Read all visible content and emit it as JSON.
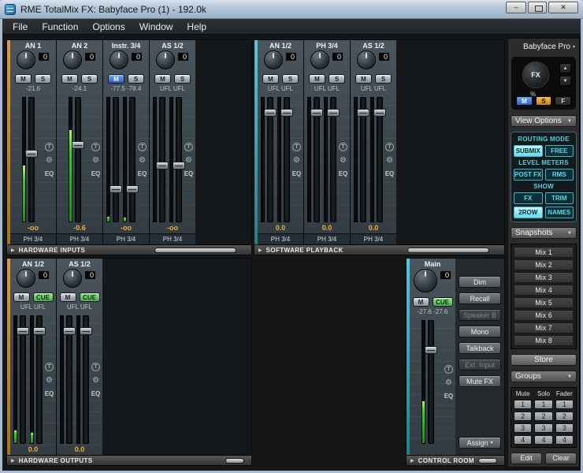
{
  "window": {
    "title": "RME TotalMix FX: Babyface Pro (1) - 192.0k",
    "controls": {
      "minimize": "–",
      "close": "✕"
    }
  },
  "menu": {
    "items": [
      "File",
      "Function",
      "Options",
      "Window",
      "Help"
    ]
  },
  "strip_common": {
    "trim": "T",
    "wrench": "⚙",
    "eq": "EQ"
  },
  "sections": {
    "hardware_inputs": {
      "bar_label": "HARDWARE INPUTS",
      "strips": [
        {
          "name": "AN 1",
          "gain": "0",
          "mute": "M",
          "solo": "S",
          "level": "-21.6",
          "stereo": false,
          "fader": 0.45,
          "meters": [
            0.45
          ],
          "value": "-oo",
          "route": "PH 3/4"
        },
        {
          "name": "AN 2",
          "gain": "0",
          "mute": "M",
          "solo": "S",
          "level": "-24.1",
          "stereo": false,
          "fader": 0.38,
          "meters": [
            0.74
          ],
          "value": "-0.6",
          "route": "PH 3/4"
        },
        {
          "name": "Instr. 3/4",
          "gain": "0",
          "mute": "M",
          "solo": "S",
          "mute_active": true,
          "level": "-77.5 -78.4",
          "stereo": true,
          "fader": 0.74,
          "meters": [
            0.04,
            0.03
          ],
          "value": "-oo",
          "route": "PH 3/4"
        },
        {
          "name": "AS 1/2",
          "gain": "0",
          "mute": "M",
          "solo": "S",
          "level": "UFL UFL",
          "stereo": true,
          "fader": 0.55,
          "meters": [
            0,
            0
          ],
          "value": "-oo",
          "route": "PH 3/4"
        }
      ]
    },
    "software_playback": {
      "bar_label": "SOFTWARE PLAYBACK",
      "strips": [
        {
          "name": "AN 1/2",
          "gain": "0",
          "mute": "M",
          "solo": "S",
          "level": "UFL UFL",
          "stereo": true,
          "fader": 0.12,
          "meters": [
            0,
            0
          ],
          "value": "0.0",
          "route": "PH 3/4"
        },
        {
          "name": "PH 3/4",
          "gain": "0",
          "mute": "M",
          "solo": "S",
          "level": "UFL UFL",
          "stereo": true,
          "fader": 0.12,
          "meters": [
            0,
            0
          ],
          "value": "0.0",
          "route": "PH 3/4"
        },
        {
          "name": "AS 1/2",
          "gain": "0",
          "mute": "M",
          "solo": "S",
          "level": "UFL UFL",
          "stereo": true,
          "fader": 0.12,
          "meters": [
            0,
            0
          ],
          "value": "0.0",
          "route": "PH 3/4"
        }
      ]
    },
    "hardware_outputs": {
      "bar_label": "HARDWARE OUTPUTS",
      "strips": [
        {
          "name": "AN 1/2",
          "gain": "0",
          "mute": "M",
          "cue": "CUE",
          "cue_active": true,
          "level": "UFL UFL",
          "stereo": true,
          "fader": 0.12,
          "meters": [
            0.1,
            0.08
          ],
          "value": "0.0"
        },
        {
          "name": "AS 1/2",
          "gain": "0",
          "mute": "M",
          "cue": "CUE",
          "cue_active": true,
          "level": "UFL UFL",
          "stereo": true,
          "fader": 0.12,
          "meters": [
            0,
            0
          ],
          "value": "0.0"
        }
      ]
    },
    "control_room": {
      "bar_label": "CONTROL ROOM",
      "main": {
        "name": "Main",
        "gain": "0",
        "mute": "M",
        "cue": "CUE",
        "cue_active": true,
        "level": "-27.6 -27.6",
        "stereo": false,
        "fader": 0.24,
        "meters": [
          0.34
        ],
        "value": ""
      },
      "buttons": [
        {
          "label": "Dim"
        },
        {
          "label": "Recall"
        },
        {
          "label": "Speaker B",
          "disabled": true
        },
        {
          "label": "Mono"
        },
        {
          "label": "Talkback"
        },
        {
          "label": "Ext. Input",
          "disabled": true
        },
        {
          "label": "Mute FX"
        },
        {
          "label": "Assign",
          "arrow": "▾"
        }
      ]
    }
  },
  "right_panel": {
    "device": {
      "label": "Babyface Pro",
      "arrow": "▾"
    },
    "fx": {
      "label": "FX",
      "percent": "%",
      "up": "▲",
      "down": "▼",
      "m": "M",
      "s": "S",
      "f": "F"
    },
    "view_options": {
      "label": "View Options",
      "arrow": "▼"
    },
    "routing": {
      "routing_mode_label": "ROUTING MODE",
      "submix": "SUBMIX",
      "free": "FREE",
      "level_meters_label": "LEVEL METERS",
      "post_fx": "POST FX",
      "rms": "RMS",
      "show_label": "SHOW",
      "fx": "FX",
      "trim": "TRIM",
      "tworow": "2ROW",
      "names": "NAMES"
    },
    "snapshots": {
      "label": "Snapshots",
      "arrow": "▼",
      "items": [
        "Mix 1",
        "Mix 2",
        "Mix 3",
        "Mix 4",
        "Mix 5",
        "Mix 6",
        "Mix 7",
        "Mix 8"
      ],
      "store": "Store"
    },
    "groups": {
      "label": "Groups",
      "arrow": "▼",
      "headers": [
        "Mute",
        "Solo",
        "Fader"
      ],
      "rows": [
        [
          "1",
          "1",
          "1"
        ],
        [
          "2",
          "2",
          "2"
        ],
        [
          "3",
          "3",
          "3"
        ],
        [
          "4",
          "4",
          "4"
        ]
      ],
      "edit": "Edit",
      "clear": "Clear"
    }
  }
}
